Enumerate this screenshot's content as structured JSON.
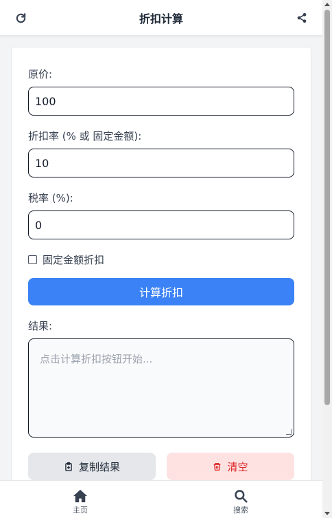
{
  "header": {
    "title": "折扣计算",
    "refresh_icon": "refresh-icon",
    "share_icon": "share-icon"
  },
  "form": {
    "original_price_label": "原价:",
    "original_price_value": "100",
    "discount_label": "折扣率 (% 或 固定金额):",
    "discount_value": "10",
    "tax_label": "税率 (%):",
    "tax_value": "0",
    "fixed_amount_label": "固定金额折扣",
    "fixed_amount_checked": false,
    "calculate_label": "计算折扣"
  },
  "result": {
    "label": "结果:",
    "placeholder": "点击计算折扣按钮开始..."
  },
  "actions": {
    "copy_label": "复制结果",
    "clear_label": "清空"
  },
  "nav": {
    "home_label": "主页",
    "search_label": "搜索"
  },
  "colors": {
    "primary": "#3b82f6",
    "danger_text": "#dc2626",
    "danger_bg": "#fee2e2",
    "neutral_bg": "#e5e7eb"
  }
}
